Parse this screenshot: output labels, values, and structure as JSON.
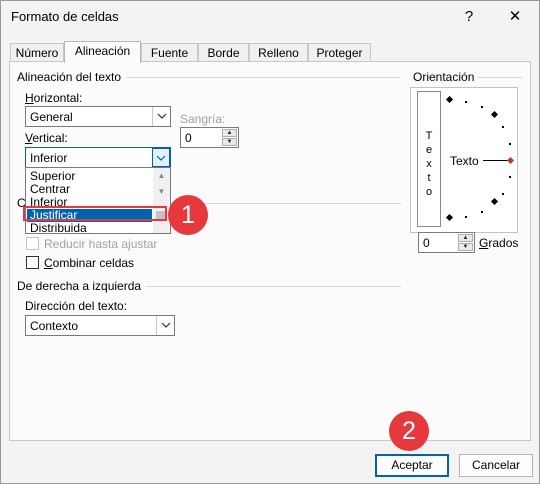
{
  "window": {
    "title": "Formato de celdas",
    "help": "?",
    "close": "✕"
  },
  "tabs": [
    "Número",
    "Alineación",
    "Fuente",
    "Borde",
    "Relleno",
    "Proteger"
  ],
  "active_tab": "Alineación",
  "alineacion": {
    "section_title": "Alineación del texto",
    "horizontal_label": "Horizontal:",
    "horizontal_value": "General",
    "sangria_label": "Sangría:",
    "sangria_value": "0",
    "vertical_label": "Vertical:",
    "vertical_value": "Inferior",
    "dropdown_options": [
      "Superior",
      "Centrar",
      "Inferior",
      "Justificar",
      "Distribuida"
    ],
    "dropdown_selected": "Justificar"
  },
  "control": {
    "section_title_visible": "C",
    "reducir_label": "Reducir hasta ajustar",
    "combinar_label": "Combinar celdas"
  },
  "rtl": {
    "section_title": "De derecha a izquierda",
    "direccion_label": "Dirección del texto:",
    "direccion_value": "Contexto"
  },
  "orientacion": {
    "section_title": "Orientación",
    "vertical_text": [
      "T",
      "e",
      "x",
      "t",
      "o"
    ],
    "text_label": "Texto",
    "degrees_value": "0",
    "degrees_label": "Grados"
  },
  "annotations": {
    "step1": "1",
    "step2": "2",
    "marker_color": "#e5393d"
  },
  "buttons": {
    "accept": "Aceptar",
    "cancel": "Cancelar"
  },
  "colors": {
    "selection": "#0063b1",
    "focus_border": "#0063b1"
  },
  "icons": {
    "combo_arrow": "chevron-down-icon",
    "spin_up": "triangle-up-icon",
    "spin_down": "triangle-down-icon"
  }
}
